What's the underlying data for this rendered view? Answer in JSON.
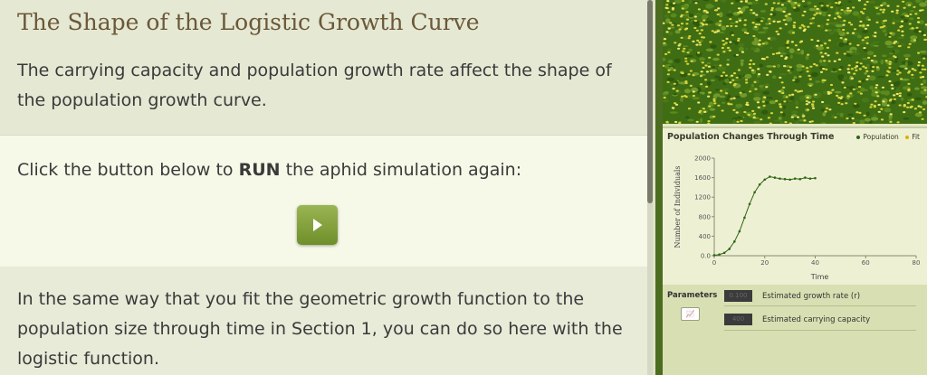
{
  "page": {
    "title": "The Shape of the Logistic Growth Curve",
    "intro": "The carrying capacity and population growth rate affect the shape of the population growth curve.",
    "run_prefix": "Click the button below to ",
    "run_bold": "RUN",
    "run_suffix": " the aphid simulation again:",
    "followup": "In the same way that you fit the geometric growth function to the population size through time in Section 1, you can do so here with the logistic function."
  },
  "colors": {
    "accent_green": "#7fa03c",
    "title_brown": "#6b5838",
    "series_population": "#2e6614",
    "series_fit": "#e0b000"
  },
  "icons": {
    "play": "play-icon",
    "params": "chart-icon"
  },
  "chart_data": {
    "type": "scatter",
    "title": "Population Changes Through Time",
    "xlabel": "Time",
    "ylabel": "Number of Individuals",
    "xlim": [
      0,
      80
    ],
    "ylim": [
      0,
      2000
    ],
    "xticks": [
      "0",
      "20",
      "40",
      "60",
      "80"
    ],
    "yticks": [
      "0.0",
      "400",
      "800",
      "1200",
      "1600",
      "2000"
    ],
    "legend": "top-right",
    "series": [
      {
        "name": "Population",
        "color": "#2e6614",
        "x": [
          0,
          2,
          4,
          6,
          8,
          10,
          12,
          14,
          16,
          18,
          20,
          22,
          24,
          26,
          28,
          30,
          32,
          34,
          36,
          38,
          40
        ],
        "y": [
          10,
          25,
          60,
          140,
          290,
          500,
          780,
          1060,
          1300,
          1460,
          1560,
          1620,
          1600,
          1580,
          1570,
          1560,
          1580,
          1570,
          1600,
          1580,
          1590
        ]
      },
      {
        "name": "Fit",
        "color": "#e0b000",
        "x": [],
        "y": []
      }
    ]
  },
  "params": {
    "label": "Parameters",
    "r_value": "0.100",
    "r_name": "Estimated growth rate (r)",
    "k_value": "400",
    "k_name": "Estimated carrying capacity"
  }
}
